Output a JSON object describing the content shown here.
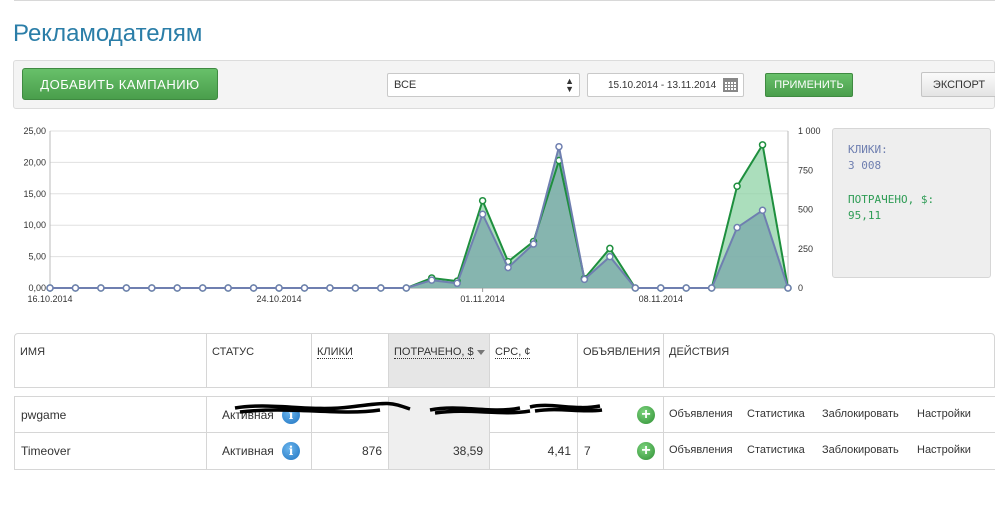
{
  "page": {
    "title": "Рекламодателям"
  },
  "toolbar": {
    "add_button": "ДОБАВИТЬ КАМПАНИЮ",
    "filter_value": "ВСЕ",
    "date_range": "15.10.2014 - 13.11.2014",
    "apply_button": "ПРИМЕНИТЬ",
    "export_button": "ЭКСПОРТ"
  },
  "stats": {
    "clicks_label": "КЛИКИ:",
    "clicks_value": "3 008",
    "spent_label": "ПОТРАЧЕНО, $:",
    "spent_value": "95,11"
  },
  "colors": {
    "accent_green": "#4aa84c",
    "spent_line": "#1e8f3e",
    "spent_fill": "#8fd3a6",
    "clicks_line": "#6f7fb0",
    "clicks_fill": "#7aa7ab",
    "title_blue": "#2b7ea8"
  },
  "chart_data": {
    "type": "area",
    "x_tick_labels": [
      "16.10.2014",
      "24.10.2014",
      "01.11.2014",
      "08.11.2014"
    ],
    "x_tick_index": [
      0,
      9,
      17,
      24
    ],
    "left_ticks": [
      "25,00",
      "20,00",
      "15,00",
      "10,00",
      "5,00",
      "0,00"
    ],
    "right_ticks": [
      "1 000",
      "750",
      "500",
      "250",
      "0"
    ],
    "left_range": [
      0,
      25
    ],
    "right_range": [
      0,
      1000
    ],
    "grid": true,
    "series": [
      {
        "axis": "left",
        "color": "#1e8f3e",
        "fill": "#8fd3a6",
        "values": [
          0,
          0,
          0,
          0,
          0,
          0,
          0,
          0,
          0,
          0,
          0,
          0,
          0,
          0,
          0,
          1.6,
          1.1,
          13.9,
          4.2,
          7.4,
          20.3,
          1.5,
          6.3,
          0,
          0,
          0,
          0,
          16.2,
          22.8,
          0
        ]
      },
      {
        "axis": "right",
        "color": "#6f7fb0",
        "fill": "#7aa7ab",
        "values": [
          0,
          0,
          0,
          0,
          0,
          0,
          0,
          0,
          0,
          0,
          0,
          0,
          0,
          0,
          0,
          50,
          30,
          470,
          130,
          280,
          900,
          55,
          200,
          0,
          0,
          0,
          0,
          385,
          495,
          0
        ]
      }
    ]
  },
  "table": {
    "headers": {
      "name": "ИМЯ",
      "status": "СТАТУС",
      "clicks": "КЛИКИ",
      "spent": "ПОТРАЧЕНО, $",
      "cpc": "CPC, ¢",
      "ads": "ОБЪЯВЛЕНИЯ",
      "actions": "ДЕЙСТВИЯ"
    },
    "rows": [
      {
        "name": "pwgame",
        "status": "Активная",
        "clicks": "",
        "spent": "",
        "cpc": "",
        "ads": "",
        "a1": "Объявления",
        "a2": "Статистика",
        "a3": "Заблокировать",
        "a4": "Настройки"
      },
      {
        "name": "Timeover",
        "status": "Активная",
        "clicks": "876",
        "spent": "38,59",
        "cpc": "4,41",
        "ads": "7",
        "a1": "Объявления",
        "a2": "Статистика",
        "a3": "Заблокировать",
        "a4": "Настройки"
      }
    ]
  }
}
